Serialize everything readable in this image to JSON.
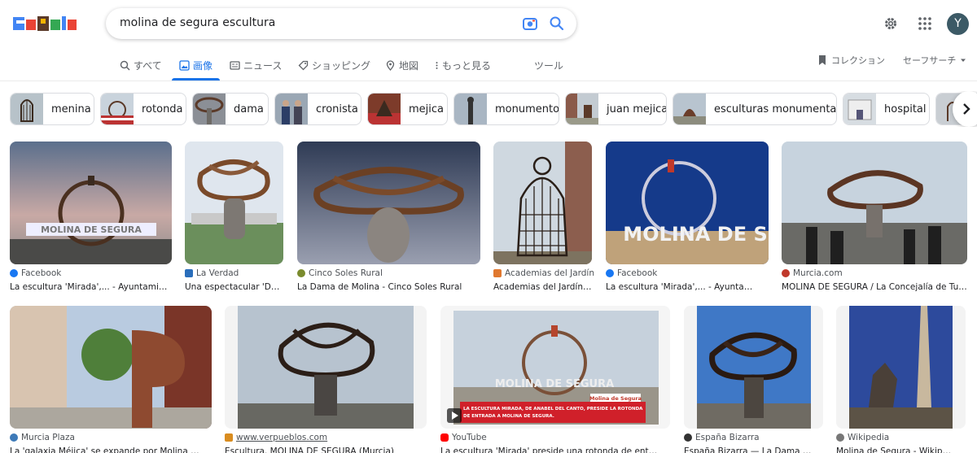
{
  "search": {
    "query": "molina de segura escultura"
  },
  "account": {
    "initial": "Y"
  },
  "tabs": [
    {
      "label": "すべて",
      "icon": "search-icon"
    },
    {
      "label": "画像",
      "icon": "image-icon",
      "active": true
    },
    {
      "label": "ニュース",
      "icon": "news-icon"
    },
    {
      "label": "ショッピング",
      "icon": "tag-icon"
    },
    {
      "label": "地図",
      "icon": "map-pin-icon"
    },
    {
      "label": "もっと見る",
      "icon": "more-icon"
    },
    {
      "label": "ツール"
    }
  ],
  "right_tools": {
    "collections": "コレクション",
    "safesearch": "セーフサーチ"
  },
  "chips": [
    "menina",
    "rotonda",
    "dama",
    "cronista",
    "mejica",
    "monumento",
    "juan mejica",
    "esculturas monumentales",
    "hospital"
  ],
  "results": [
    {
      "source": "Facebook",
      "title": "La escultura 'Mirada',... - Ayuntamiento de ...",
      "src_color": "#1877f2"
    },
    {
      "source": "La Verdad",
      "title": "Una espectacular 'Dama' ...",
      "src_color": "#2a6ebb"
    },
    {
      "source": "Cinco Soles Rural",
      "title": "La Dama de Molina - Cinco Soles Rural",
      "src_color": "#7a8b2e"
    },
    {
      "source": "Academias del Jardín",
      "title": "Academias del Jardín: ...",
      "src_color": "#e0782f"
    },
    {
      "source": "Facebook",
      "title": "La escultura 'Mirada',... - Ayuntamiento de ...",
      "src_color": "#1877f2"
    },
    {
      "source": "Murcia.com",
      "title": "MOLINA DE SEGURA / La Concejalía de Turismo ...",
      "src_color": "#c0392b"
    },
    {
      "source": "Murcia Plaza",
      "title": "La 'galaxia Méjica' se expande por Molina de Segura ...",
      "src_color": "#3d7ab8"
    },
    {
      "source": "www.verpueblos.com",
      "title": "Escultura. MOLINA DE SEGURA (Murcia)",
      "src_color": "#d98c1f"
    },
    {
      "source": "YouTube",
      "title": "La escultura 'Mirada' preside una rotonda de entrada a Molina ...",
      "src_color": "#ff0000"
    },
    {
      "source": "España Bizarra",
      "title": "España Bizarra — La Dama de Molina ...",
      "src_color": "#333333"
    },
    {
      "source": "Wikipedia",
      "title": "Molina de Segura - Wikipedia, la ...",
      "src_color": "#666666"
    }
  ],
  "image_text": {
    "sign_1": "MOLINA DE SEGURA",
    "sign_5": "MOLINA DE S",
    "yt_sign": "MOLINA DE SEGURA",
    "yt_caption_1": "LA ESCULTURA MIRADA, DE ANABEL DEL CANTO, PRESIDE LA ROTONDA",
    "yt_caption_2": "DE ENTRADA A MOLINA DE SEGURA.",
    "yt_tag": "Molina de Segura"
  }
}
